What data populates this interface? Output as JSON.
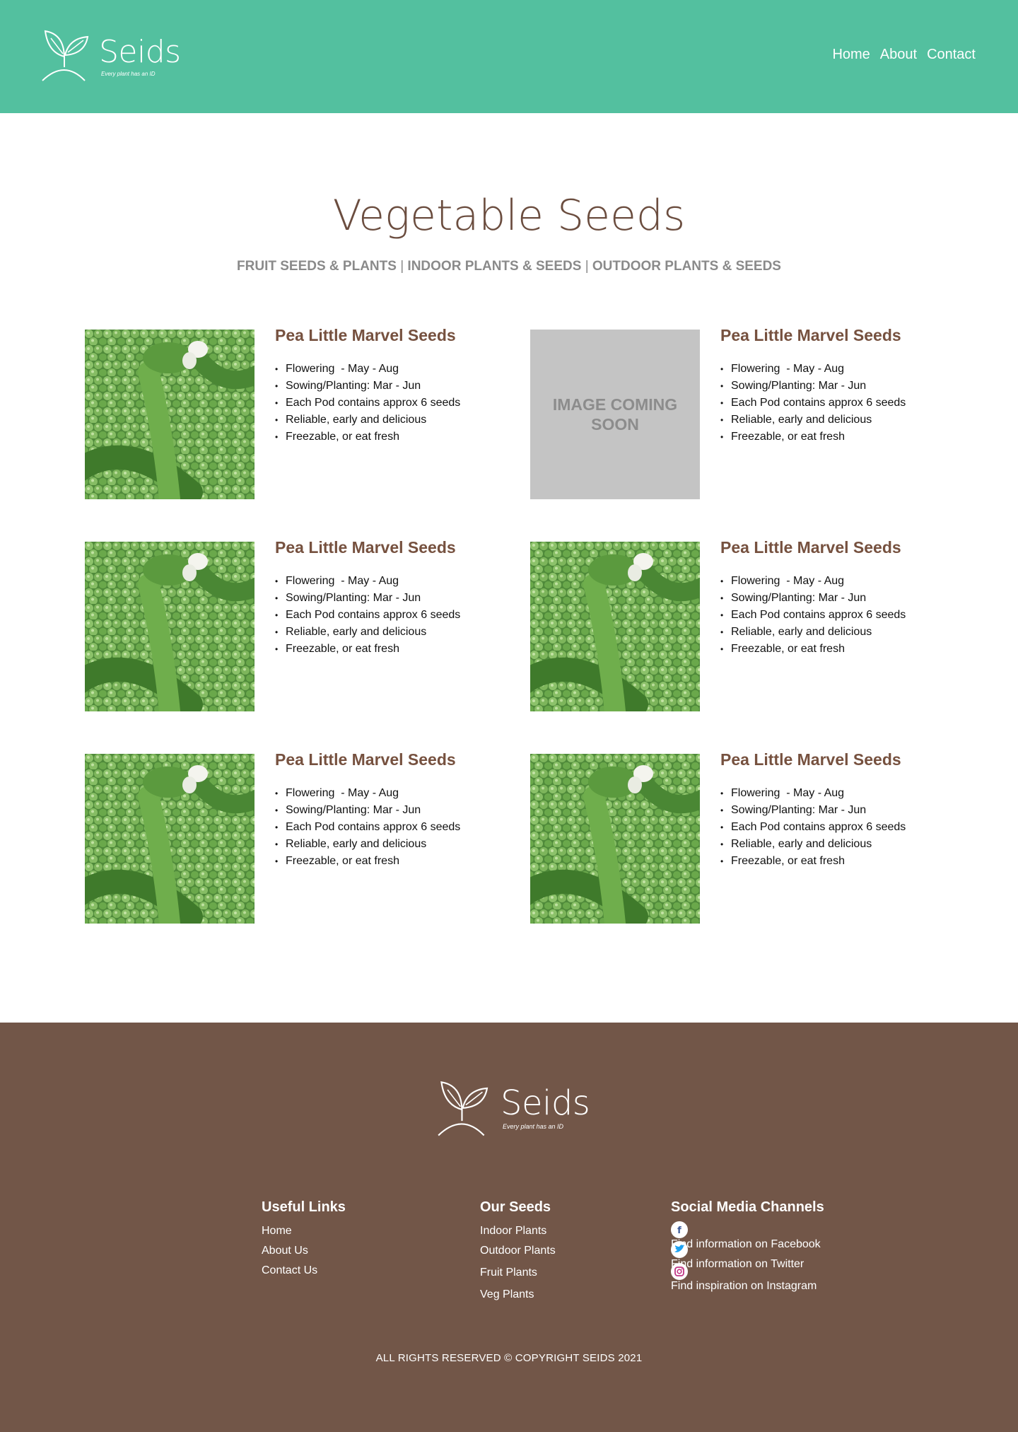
{
  "brand": {
    "name": "Seids",
    "tagline": "Every plant has an ID"
  },
  "nav": {
    "home": "Home",
    "about": "About",
    "contact": "Contact"
  },
  "page": {
    "title": "Vegetable Seeds",
    "categories": [
      "FRUIT SEEDS & PLANTS",
      "INDOOR PLANTS & SEEDS",
      "OUTDOOR PLANTS & SEEDS"
    ],
    "separator": "|"
  },
  "products": [
    {
      "title": "Pea Little Marvel Seeds",
      "image": "pea-photo",
      "features": [
        "Flowering  - May - Aug",
        "Sowing/Planting: Mar - Jun",
        "Each Pod contains approx 6 seeds",
        "Reliable, early and delicious",
        "Freezable, or eat fresh"
      ]
    },
    {
      "title": "Pea Little Marvel Seeds",
      "image": "placeholder",
      "placeholder_text": "IMAGE COMING SOON",
      "features": [
        "Flowering  - May - Aug",
        "Sowing/Planting: Mar - Jun",
        "Each Pod contains approx 6 seeds",
        "Reliable, early and delicious",
        "Freezable, or eat fresh"
      ]
    },
    {
      "title": "Pea Little Marvel Seeds",
      "image": "pea-photo",
      "features": [
        "Flowering  - May - Aug",
        "Sowing/Planting: Mar - Jun",
        "Each Pod contains approx 6 seeds",
        "Reliable, early and delicious",
        "Freezable, or eat fresh"
      ]
    },
    {
      "title": "Pea Little Marvel Seeds",
      "image": "pea-photo",
      "features": [
        "Flowering  - May - Aug",
        "Sowing/Planting: Mar - Jun",
        "Each Pod contains approx 6 seeds",
        "Reliable, early and delicious",
        "Freezable, or eat fresh"
      ]
    },
    {
      "title": "Pea Little Marvel Seeds",
      "image": "pea-photo",
      "features": [
        "Flowering  - May - Aug",
        "Sowing/Planting: Mar - Jun",
        "Each Pod contains approx 6 seeds",
        "Reliable, early and delicious",
        "Freezable, or eat fresh"
      ]
    },
    {
      "title": "Pea Little Marvel Seeds",
      "image": "pea-photo",
      "features": [
        "Flowering  - May - Aug",
        "Sowing/Planting: Mar - Jun",
        "Each Pod contains approx 6 seeds",
        "Reliable, early and delicious",
        "Freezable, or eat fresh"
      ]
    }
  ],
  "footer": {
    "useful_links": {
      "heading": "Useful Links",
      "items": [
        "Home",
        "About Us",
        "Contact Us"
      ]
    },
    "our_seeds": {
      "heading": "Our Seeds",
      "items": [
        "Indoor Plants",
        "Outdoor Plants",
        "Fruit Plants",
        "Veg Plants"
      ]
    },
    "social": {
      "heading": "Social Media Channels",
      "items": [
        {
          "label": "Find information on Facebook",
          "icon": "facebook-icon"
        },
        {
          "label": "Find information on Twitter",
          "icon": "twitter-icon"
        },
        {
          "label": "Find inspiration on Instagram",
          "icon": "instagram-icon"
        }
      ]
    },
    "copyright": "ALL RIGHTS RESERVED © COPYRIGHT SEIDS 2021"
  },
  "colors": {
    "header_bg": "#53c09f",
    "footer_bg": "#725648",
    "title_brown": "#6b4d3f",
    "product_title": "#76513f",
    "placeholder_bg": "#c4c4c4"
  }
}
